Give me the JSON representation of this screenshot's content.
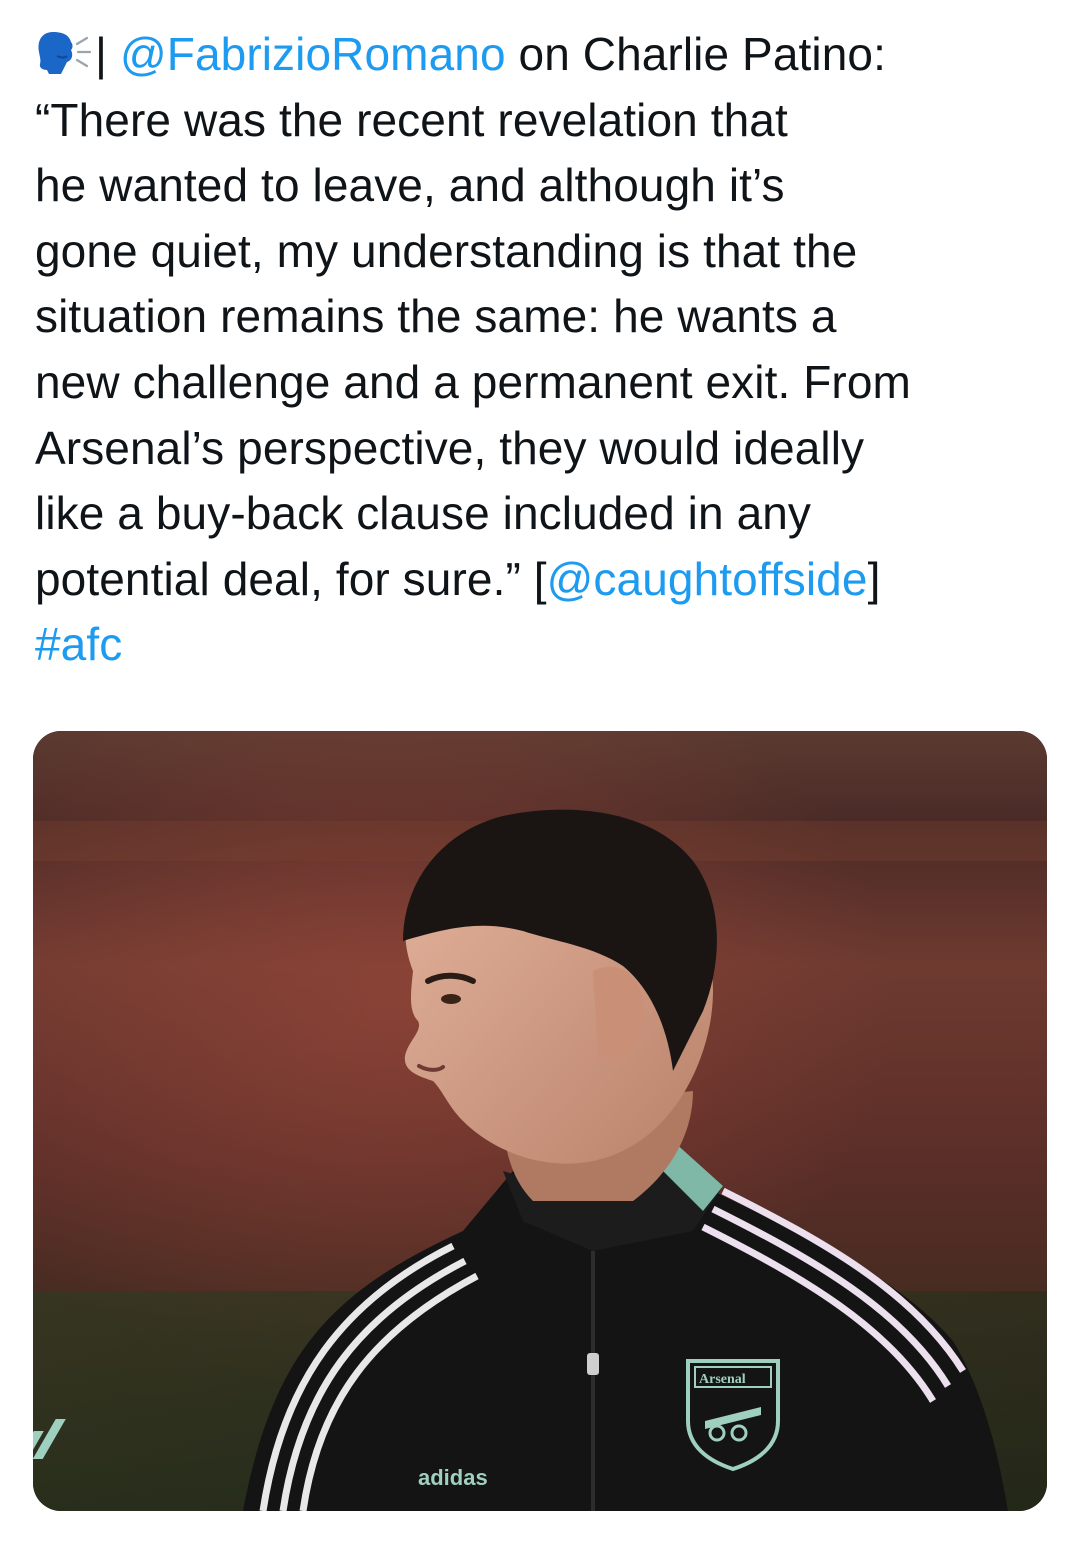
{
  "tweet": {
    "speaker_icon": "speaking-head-icon",
    "separator": "|",
    "mention": "@FabrizioRomano",
    "lead": " on Charlie Patino:",
    "lines": [
      "“There was the recent revelation that",
      "he wanted to leave, and although it’s",
      "gone quiet, my understanding is that the",
      "situation remains the same: he wants a",
      "new challenge and a permanent exit. From",
      "Arsenal’s perspective, they would ideally",
      "like a buy-back clause included in any"
    ],
    "last_line_text": "potential deal, for sure.” [",
    "source_mention": "@caughtoffside",
    "last_line_close": "]",
    "hashtag": "#afc"
  },
  "media": {
    "crest_text": "Arsenal",
    "brand_text": "adidas"
  },
  "colors": {
    "link": "#1d9bf0",
    "text": "#0f1419",
    "jersey": "#151515",
    "trim": "#7fb8a6"
  }
}
